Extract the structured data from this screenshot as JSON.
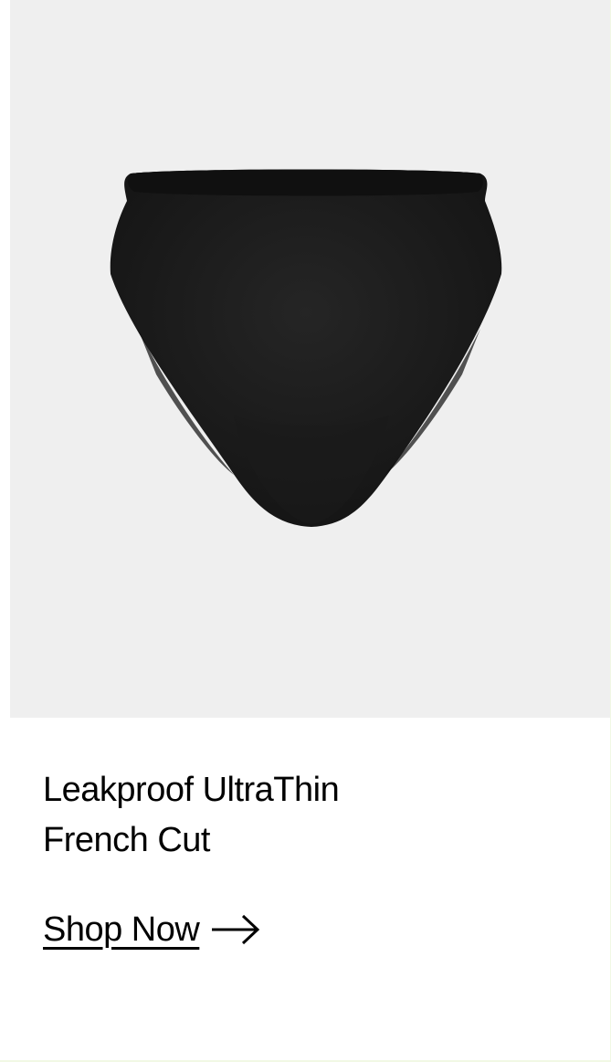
{
  "product": {
    "image_alt": "Leakproof UltraThin French Cut",
    "title_line1": "Leakproof UltraThin",
    "title_line2": "French Cut"
  },
  "cta": {
    "label": "Shop Now",
    "icon": "arrow-right-icon"
  },
  "colors": {
    "panel_background": "#efefef",
    "product_fabric": "#1b1b1b",
    "text": "#000000"
  }
}
